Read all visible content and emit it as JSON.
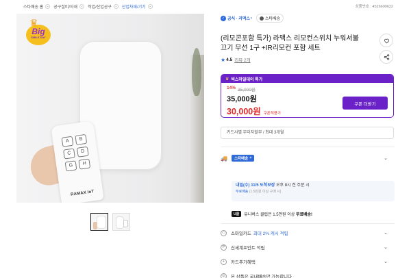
{
  "breadcrumb": {
    "items": [
      "스타배송 홈",
      "공구절비/자재",
      "작업/산업공구",
      "산업자재/기기"
    ],
    "item_number": "상품번호 : 4526600622"
  },
  "main_image": {
    "badge": {
      "big": "Big",
      "sub": "SMILE DAY"
    },
    "remote_keys": [
      "A",
      "B",
      "C",
      "D",
      "G",
      "H"
    ],
    "remote_brand": "RAMAX IoT"
  },
  "thumbnails": {
    "count": 2,
    "selected_index": 0
  },
  "seller": {
    "official": "공식 · 라맥스",
    "store": "스타배송"
  },
  "product": {
    "title": "(리모콘포함 특가) 라맥스 리모컨스위치 누워서불끄기 무선 1구 +IR리모컨 포함 세트",
    "rating": "4.5",
    "reviews": "리뷰 2개"
  },
  "deal": {
    "header": "빅스마일데이 특가",
    "discount": "14%",
    "original_price": "35,000원",
    "sale_price": "35,000원",
    "coupon_price": "30,000원",
    "coupon_label": "쿠폰적용가",
    "coupon_button": "쿠폰 더받기"
  },
  "card_select": {
    "text": "카드사별 무이자할부 / 최대 3개월"
  },
  "shipping": {
    "badge": "스타배송"
  },
  "delivery": {
    "date": "내일(수) 11/5",
    "guarantee": "도착보장",
    "deadline": "오후 8시 전 주문 시",
    "free": "무료배송",
    "free_note": "(1.5만원 이상 구매 시)"
  },
  "wow": {
    "badge": "U클",
    "text_prefix": "유니버스 클럽은 1.5만원 이상",
    "text_bold": "무료배송!"
  },
  "info_rows": [
    {
      "label": "스마일카드",
      "highlight": "최대 2% 캐시 적립",
      "icon": "card-icon"
    },
    {
      "label": "신세계포인트 적립",
      "highlight": "",
      "icon": "point-icon"
    },
    {
      "label": "카드추가혜택",
      "highlight": "",
      "icon": "card-plus-icon"
    },
    {
      "label": "본 상품은 국내배송만 가능합니다",
      "highlight": "",
      "icon": "globe-icon"
    }
  ],
  "colors": {
    "accent": "#6a22c8",
    "blue": "#2f6ad9",
    "red": "#e12a2a"
  }
}
